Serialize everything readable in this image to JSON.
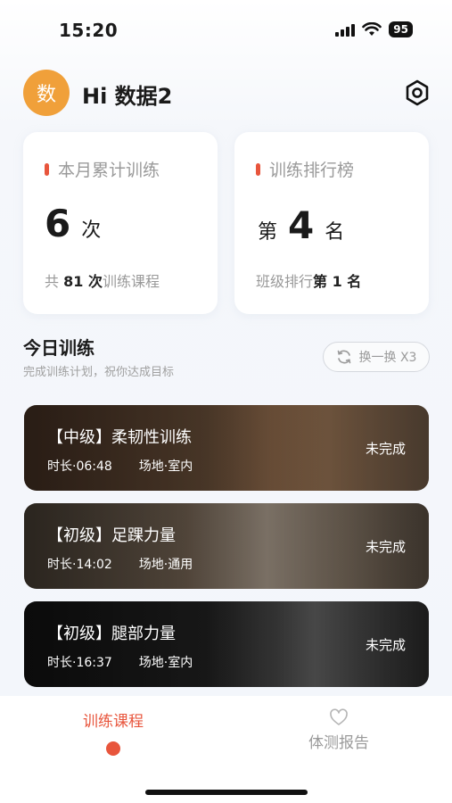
{
  "status_bar": {
    "time": "15:20",
    "battery": "95"
  },
  "header": {
    "avatar_text": "数",
    "greeting": "Hi 数据2"
  },
  "stats": {
    "monthly": {
      "title": "本月累计训练",
      "value": "6",
      "unit": "次",
      "foot_prefix": "共",
      "foot_count": "81 次",
      "foot_suffix": "训练课程"
    },
    "ranking": {
      "title": "训练排行榜",
      "prefix": "第",
      "value": "4",
      "unit": "名",
      "foot_label": "班级排行",
      "foot_rank": "第 1 名"
    }
  },
  "today": {
    "title": "今日训练",
    "subtitle": "完成训练计划，祝你达成目标",
    "swap_label": "换一换 X3"
  },
  "courses": [
    {
      "title": "【中级】柔韧性训练",
      "duration": "时长·06:48",
      "venue": "场地·室内",
      "status": "未完成"
    },
    {
      "title": "【初级】足踝力量",
      "duration": "时长·14:02",
      "venue": "场地·通用",
      "status": "未完成"
    },
    {
      "title": "【初级】腿部力量",
      "duration": "时长·16:37",
      "venue": "场地·室内",
      "status": "未完成"
    }
  ],
  "tabbar": {
    "train": "训练课程",
    "report": "体测报告"
  },
  "colors": {
    "accent": "#e8553c",
    "avatar": "#f0a03a"
  }
}
